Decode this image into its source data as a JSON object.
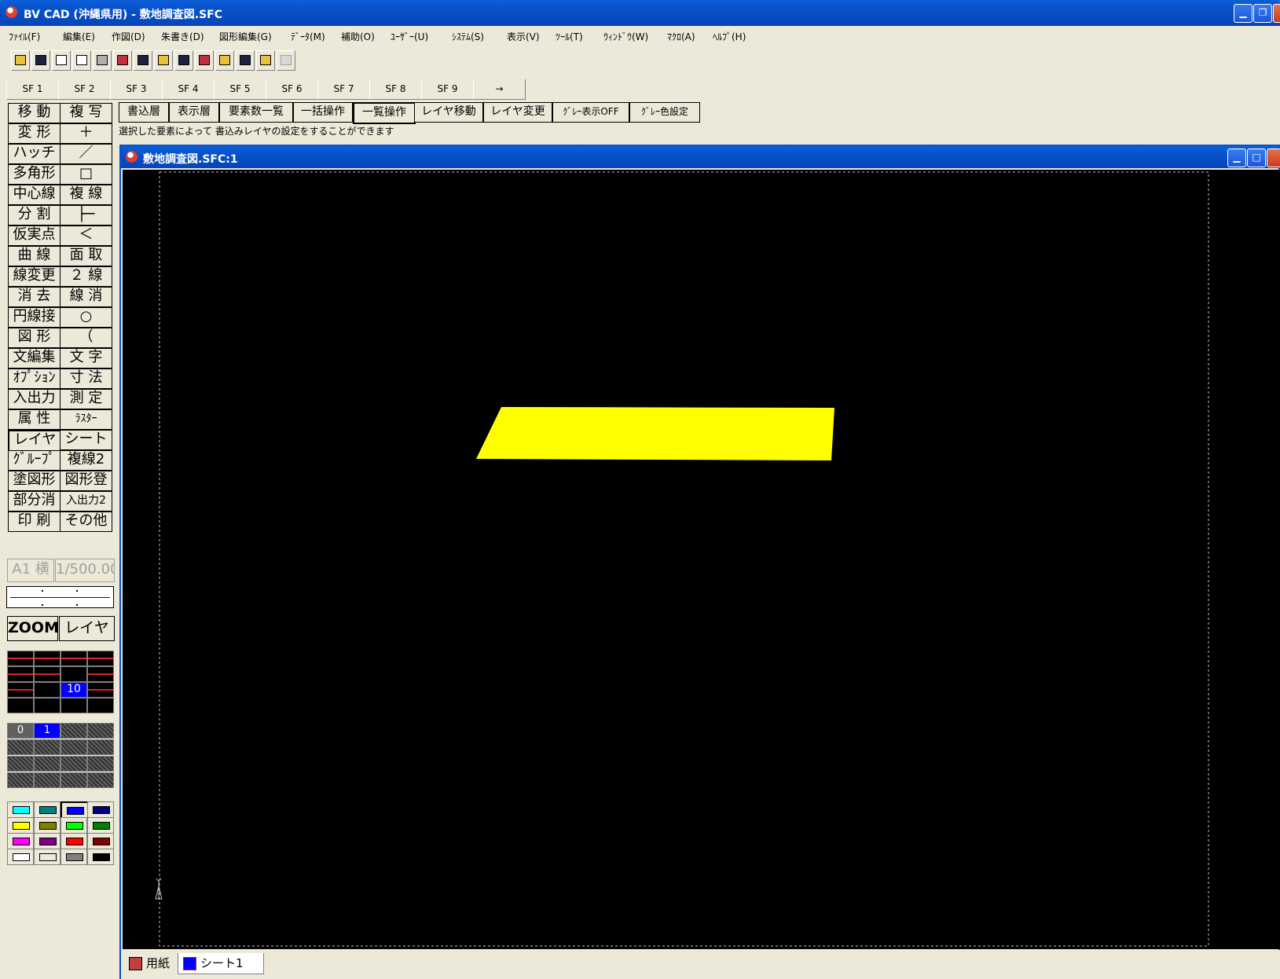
{
  "window": {
    "title": "BV CAD (沖縄県用) - 敷地調査図.SFC"
  },
  "menu": [
    "ﾌｧｲﾙ(F)",
    "編集(E)",
    "作図(D)",
    "朱書き(D)",
    "図形編集(G)",
    "ﾃﾞｰﾀ(M)",
    "補助(O)",
    "ﾕｰｻﾞｰ(U)",
    "ｼｽﾃﾑ(S)",
    "表示(V)",
    "ﾂｰﾙ(T)",
    "ｳｨﾝﾄﾞｳ(W)",
    "ﾏｸﾛ(A)",
    "ﾍﾙﾌﾟ(H)"
  ],
  "sf_tabs": [
    "SF 1",
    "SF 2",
    "SF 3",
    "SF 4",
    "SF 5",
    "SF 6",
    "SF 7",
    "SF 8",
    "SF 9",
    "→"
  ],
  "palette": [
    [
      "移 動",
      "複 写"
    ],
    [
      "変 形",
      "＋"
    ],
    [
      "ハッチ",
      "／"
    ],
    [
      "多角形",
      "□"
    ],
    [
      "中心線",
      "複 線"
    ],
    [
      "分 割",
      "├─"
    ],
    [
      "仮実点",
      "＜"
    ],
    [
      "曲 線",
      "面 取"
    ],
    [
      "線変更",
      "２ 線"
    ],
    [
      "消 去",
      "線 消"
    ],
    [
      "円線接",
      "○"
    ],
    [
      "図 形",
      "（"
    ],
    [
      "文編集",
      "文 字"
    ],
    [
      "ｵﾌﾟｼｮﾝ",
      "寸 法"
    ],
    [
      "入出力",
      "測 定"
    ],
    [
      "属 性",
      "ﾗｽﾀｰ"
    ],
    [
      "レイヤ",
      "シート"
    ],
    [
      "ｸﾞﾙｰﾌﾟ",
      "複線2"
    ],
    [
      "塗図形",
      "図形登"
    ],
    [
      "部分消",
      "入出力2"
    ],
    [
      "印 刷",
      "その他"
    ]
  ],
  "paper": {
    "size": "A1 横",
    "scale": "1/500.00"
  },
  "zoom_label": "ZOOM",
  "layer_label": "レイヤ",
  "layer_grid": {
    "selected_label": "10"
  },
  "sheet_grid": {
    "labels": [
      "0",
      "1"
    ]
  },
  "colors": [
    "#00ffff",
    "#008080",
    "#0000ff",
    "#000080",
    "#ffff00",
    "#808000",
    "#00ff00",
    "#008000",
    "#ff00ff",
    "#800080",
    "#ff0000",
    "#800000",
    "#ffffff",
    "#ece9d8",
    "#808080",
    "#000000"
  ],
  "commands": [
    "書込層",
    "表示層",
    "要素数一覧",
    "一括操作",
    "一覧操作",
    "レイヤ移動",
    "レイヤ変更",
    "ｸﾞﾚｰ表示OFF",
    "ｸﾞﾚｰ色設定"
  ],
  "status_text": "選択した要素によって 書込みレイヤの設定をすることができます",
  "child_window": {
    "title": "敷地調査図.SFC:1"
  },
  "canvas": {
    "background": "#000000",
    "shape_color": "#ffff00",
    "frame_color": "#c0c0c0"
  },
  "sheet_tabs": [
    "用紙",
    "シート1"
  ]
}
